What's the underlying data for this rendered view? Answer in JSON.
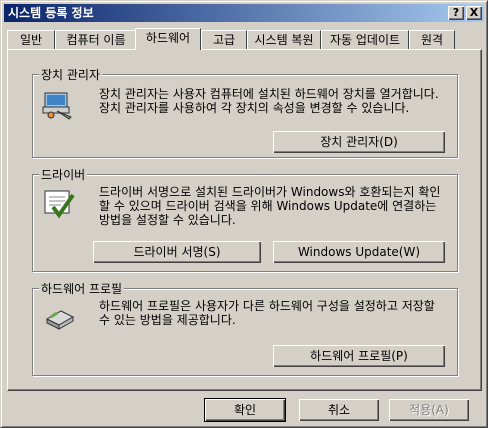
{
  "window": {
    "title": "시스템 등록 정보",
    "help_btn": "?",
    "close_btn": "X"
  },
  "tabs": [
    {
      "label": "일반"
    },
    {
      "label": "컴퓨터 이름"
    },
    {
      "label": "하드웨어"
    },
    {
      "label": "고급"
    },
    {
      "label": "시스템 복원"
    },
    {
      "label": "자동 업데이트"
    },
    {
      "label": "원격"
    }
  ],
  "device_manager": {
    "title": "장치 관리자",
    "text": "장치 관리자는 사용자 컴퓨터에 설치된 하드웨어 장치를 열거합니다. 장치 관리자를 사용하여 각 장치의 속성을 변경할 수 있습니다.",
    "button": "장치 관리자(D)"
  },
  "drivers": {
    "title": "드라이버",
    "text": "드라이버 서명으로 설치된 드라이버가 Windows와 호환되는지 확인할 수 있으며 드라이버 검색을 위해 Windows Update에 연결하는 방법을 설정할 수 있습니다.",
    "button_signing": "드라이버 서명(S)",
    "button_update": "Windows Update(W)"
  },
  "hw_profiles": {
    "title": "하드웨어 프로필",
    "text": "하드웨어 프로필은 사용자가 다른 하드웨어 구성을 설정하고 저장할 수 있는 방법을 제공합니다.",
    "button": "하드웨어 프로필(P)"
  },
  "footer": {
    "ok": "확인",
    "cancel": "취소",
    "apply": "적용(A)"
  }
}
